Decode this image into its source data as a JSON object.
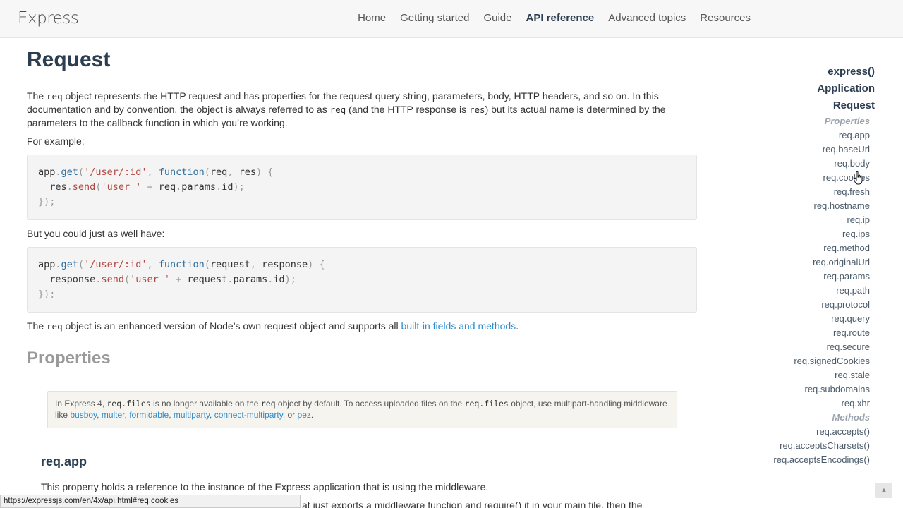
{
  "header": {
    "logo": "Express",
    "nav": [
      "Home",
      "Getting started",
      "Guide",
      "API reference",
      "Advanced topics",
      "Resources"
    ],
    "active_nav": "API reference"
  },
  "page": {
    "title": "Request",
    "intro": {
      "p1": "The ",
      "code1": "req",
      "p2": " object represents the HTTP request and has properties for the request query string, parameters, body, HTTP headers, and so on. In this documentation and by convention, the object is always referred to as ",
      "code2": "req",
      "p3": " (and the HTTP response is ",
      "code3": "res",
      "p4": ") but its actual name is determined by the parameters to the callback function in which you’re working."
    },
    "for_example": "For example:",
    "code_example_1": {
      "line1_a": "app",
      "line1_b": ".",
      "line1_c": "get",
      "line1_d": "(",
      "line1_e": "'/user/:id'",
      "line1_f": ", ",
      "line1_g": "function",
      "line1_h": "(",
      "line1_i": "req",
      "line1_j": ", ",
      "line1_k": "res",
      "line1_l": ") {",
      "line2_a": "res",
      "line2_b": ".",
      "line2_c": "send",
      "line2_d": "(",
      "line2_e": "'user '",
      "line2_f": " + ",
      "line2_g": "req",
      "line2_h": ".",
      "line2_i": "params",
      "line2_j": ".",
      "line2_k": "id",
      "line2_l": ");",
      "line3": "});"
    },
    "but_could": "But you could just as well have:",
    "code_example_2": {
      "line1_a": "app",
      "line1_b": ".",
      "line1_c": "get",
      "line1_d": "(",
      "line1_e": "'/user/:id'",
      "line1_f": ", ",
      "line1_g": "function",
      "line1_h": "(",
      "line1_i": "request",
      "line1_j": ", ",
      "line1_k": "response",
      "line1_l": ") {",
      "line2_a": "response",
      "line2_b": ".",
      "line2_c": "send",
      "line2_d": "(",
      "line2_e": "'user '",
      "line2_f": " + ",
      "line2_g": "request",
      "line2_h": ".",
      "line2_i": "params",
      "line2_j": ".",
      "line2_k": "id",
      "line2_l": ");",
      "line3": "});"
    },
    "enhanced": {
      "p1": "The ",
      "code": "req",
      "p2": " object is an enhanced version of Node’s own request object and supports all ",
      "link": "built-in fields and methods",
      "p3": "."
    },
    "properties_heading": "Properties",
    "note": {
      "t1": "In Express 4, ",
      "c1": "req.files",
      "t2": " is no longer available on the ",
      "c2": "req",
      "t3": " object by default. To access uploaded files on the ",
      "c3": "req.files",
      "t4": " object, use multipart-handling middleware like ",
      "links": [
        "busboy",
        "multer",
        "formidable",
        "multiparty",
        "connect-multiparty",
        "pez"
      ],
      "sep": ", ",
      "or": ", or ",
      "end": "."
    },
    "req_app_heading": "req.app",
    "req_app_text": "This property holds a reference to the instance of the Express application that is using the middleware.",
    "cut_text": "at just exports a middleware function and require() it in your main file, then the"
  },
  "toc": {
    "top": [
      "express()",
      "Application",
      "Request"
    ],
    "properties_label": "Properties",
    "properties": [
      "req.app",
      "req.baseUrl",
      "req.body",
      "req.cookies",
      "req.fresh",
      "req.hostname",
      "req.ip",
      "req.ips",
      "req.method",
      "req.originalUrl",
      "req.params",
      "req.path",
      "req.protocol",
      "req.query",
      "req.route",
      "req.secure",
      "req.signedCookies",
      "req.stale",
      "req.subdomains",
      "req.xhr"
    ],
    "methods_label": "Methods",
    "methods": [
      "req.accepts()",
      "req.acceptsCharsets()",
      "req.acceptsEncodings()"
    ]
  },
  "status_url": "https://expressjs.com/en/4x/api.html#req.cookies",
  "icons": {
    "scroll_top": "arrow-up-icon",
    "cursor": "hand-pointer-icon"
  }
}
